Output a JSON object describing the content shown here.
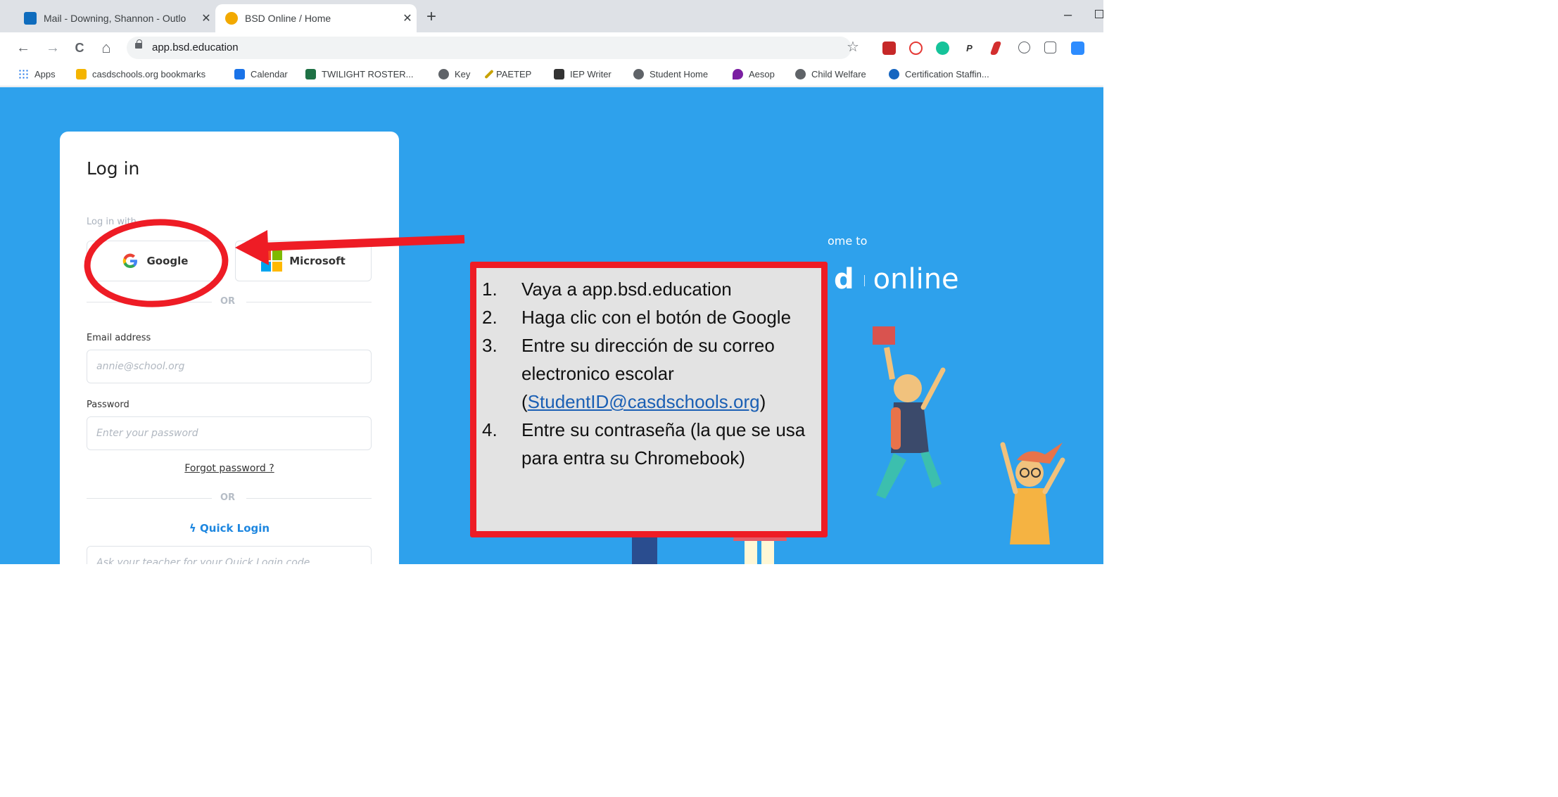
{
  "tabs": [
    {
      "title": "Mail - Downing, Shannon - Outlo",
      "close": "✕",
      "favicon_color": "#0f6cbd"
    },
    {
      "title": "BSD Online / Home",
      "close": "✕",
      "favicon_color": "#f2a900"
    }
  ],
  "new_tab_label": "+",
  "window": {
    "minimize": "–"
  },
  "nav": {
    "back": "←",
    "forward": "→",
    "reload": "C",
    "home": "⌂"
  },
  "address_bar": {
    "url": "app.bsd.education",
    "star": "☆"
  },
  "bookmarks": [
    {
      "label": "Apps",
      "icon": "apps-grid-icon",
      "color": "#1a73e8"
    },
    {
      "label": "casdschools.org bookmarks",
      "icon": "folder-icon",
      "color": "#f4b400"
    },
    {
      "label": "Calendar",
      "icon": "calendar-icon",
      "color": "#1a73e8"
    },
    {
      "label": "TWILIGHT ROSTER...",
      "icon": "excel-icon",
      "color": "#1e7145"
    },
    {
      "label": "Key",
      "icon": "globe-icon",
      "color": "#5f6368"
    },
    {
      "label": "PAETEP",
      "icon": "pen-icon",
      "color": "#c8a200"
    },
    {
      "label": "IEP Writer",
      "icon": "iep-icon",
      "color": "#333333"
    },
    {
      "label": "Student Home",
      "icon": "globe-icon",
      "color": "#5f6368"
    },
    {
      "label": "Aesop",
      "icon": "aesop-icon",
      "color": "#7b1fa2"
    },
    {
      "label": "Child Welfare",
      "icon": "globe-icon",
      "color": "#5f6368"
    },
    {
      "label": "Certification Staffin...",
      "icon": "certificate-icon",
      "color": "#1565c0"
    }
  ],
  "login": {
    "title": "Log in",
    "login_with": "Log in with",
    "google_label": "Google",
    "microsoft_label": "Microsoft",
    "or_label": "OR",
    "email_label": "Email address",
    "email_placeholder": "annie@school.org",
    "password_label": "Password",
    "password_placeholder": "Enter your password",
    "forgot_password": "Forgot password ?",
    "quick_login": "Quick Login",
    "quick_login_placeholder": "Ask your teacher for your Quick Login code"
  },
  "welcome": {
    "small": "ome to",
    "brand_d": "d",
    "brand_online": "online"
  },
  "instructions": [
    {
      "num": "1.",
      "text": "Vaya a app.bsd.education"
    },
    {
      "num": "2.",
      "text": "Haga clic con el botón de Google"
    },
    {
      "num": "3.",
      "text_before": "Entre su dirección de su correo electronico escolar (",
      "link": "StudentID@casdschools.org",
      "text_after": ")"
    },
    {
      "num": "4.",
      "text": "Entre su contraseña (la que se usa para entra su Chromebook)"
    }
  ],
  "colors": {
    "page_bg": "#2ea1ec",
    "annotation_red": "#ee1c25",
    "callout_bg": "#e3e3e3",
    "quick_login_blue": "#1e87e0"
  }
}
